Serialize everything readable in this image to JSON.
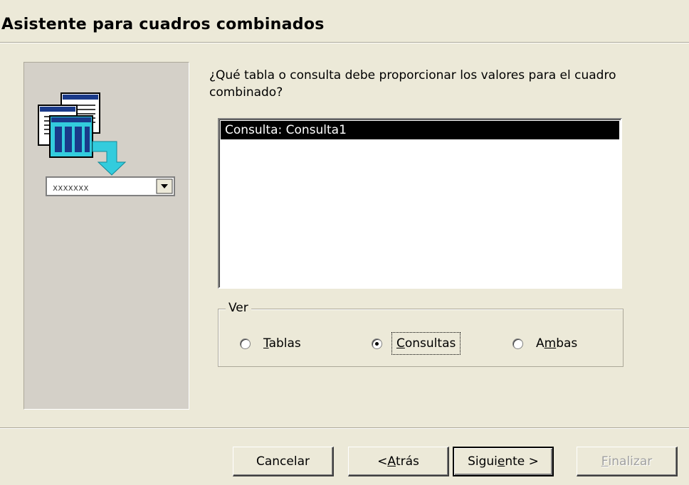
{
  "window": {
    "title": "Asistente para cuadros combinados"
  },
  "illustration": {
    "icon": "table-to-combobox-icon",
    "combo_placeholder": "xxxxxxx"
  },
  "prompt": {
    "question": "¿Qué tabla o consulta debe proporcionar los valores para el cuadro combinado?"
  },
  "list": {
    "items": [
      "Consulta: Consulta1"
    ],
    "selected_index": 0
  },
  "view_group": {
    "legend": "Ver",
    "options": [
      {
        "label_pre": "",
        "mnemonic": "T",
        "label_post": "ablas",
        "selected": false
      },
      {
        "label_pre": "",
        "mnemonic": "C",
        "label_post": "onsultas",
        "selected": true
      },
      {
        "label_pre": "A",
        "mnemonic": "m",
        "label_post": "bas",
        "selected": false
      }
    ]
  },
  "buttons": {
    "cancel": "Cancelar",
    "back_prefix": "< ",
    "back_mnemonic": "A",
    "back_rest": "trás",
    "next_pre": "Sigui",
    "next_mnemonic": "e",
    "next_rest": "nte >",
    "finish_mnemonic": "F",
    "finish_rest": "inalizar"
  },
  "colors": {
    "dialog_bg": "#ece9d8",
    "selection_bg": "#000000",
    "selection_fg": "#ffffff",
    "icon_accent": "#33ccdd"
  }
}
